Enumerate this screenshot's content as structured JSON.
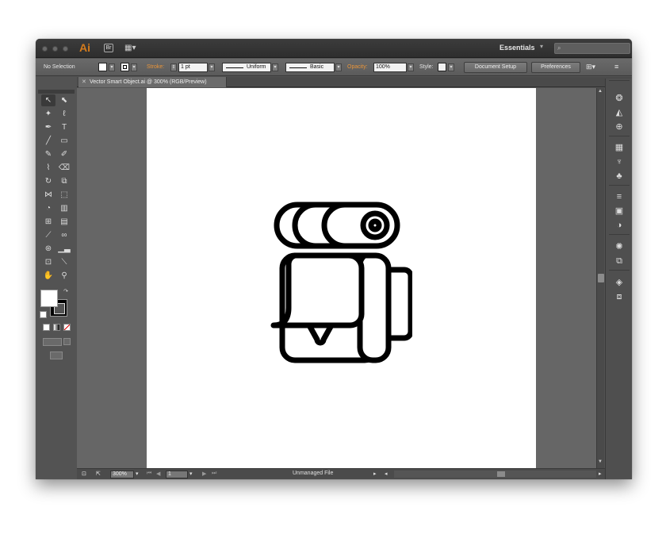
{
  "app": {
    "logo": "Ai",
    "bridge_logo": "Br",
    "workspace": "Essentials",
    "search_placeholder": ""
  },
  "control_bar": {
    "selection": "No Selection",
    "stroke_label": "Stroke:",
    "stroke_weight": "1 pt",
    "profile_label": "Uniform",
    "brush_label": "Basic",
    "opacity_label": "Opacity:",
    "opacity_value": "100%",
    "style_label": "Style:",
    "document_setup": "Document Setup",
    "preferences": "Preferences"
  },
  "document": {
    "tab_title": "Vector Smart Object.ai @ 300% (RGB/Preview)"
  },
  "status_bar": {
    "zoom": "300%",
    "artboard": "1",
    "status": "Unmanaged File"
  },
  "colors": {
    "ui_dark": "#535353",
    "canvas": "#666666",
    "artboard": "#ffffff",
    "accent_orange": "#e9953a",
    "artwork_stroke": "#000000"
  },
  "artwork": {
    "subject": "backpack-icon"
  }
}
